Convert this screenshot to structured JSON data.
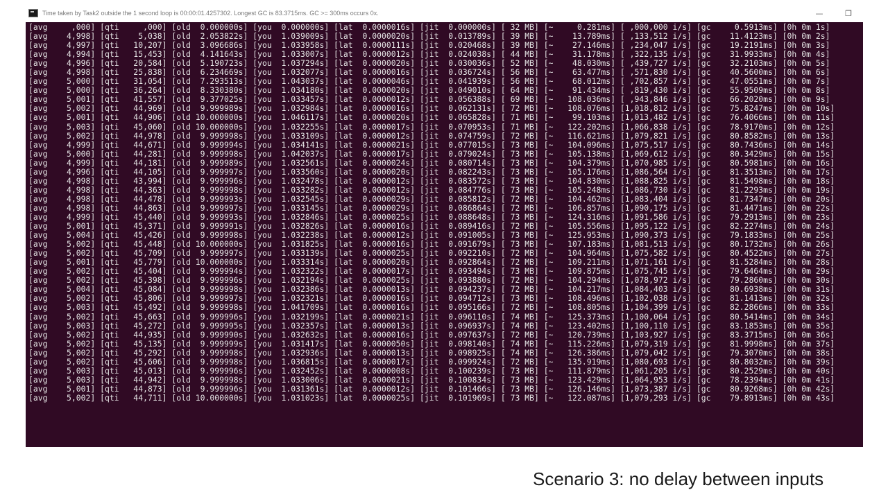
{
  "window": {
    "title": "Time taken by Task2 outside the 1 second loop is 00:00:01.4257302. Longest GC is 83.3715ms. GC >= 300ms occurs 0x.",
    "minimize_glyph": "—",
    "maximize_glyph": "❐"
  },
  "console": {
    "lines": [
      "[avg     ,000] [qti     ,000] [old  0.000000s] [you  0.000000s] [lat  0.0000016s] [jit  0.000000s] [ 32 MB] [~     0.281ms] [ ,000,000 i/s] [gc     0.5913ms] [0h 0m 1s]",
      "[avg    4,998] [qti    5,038] [old  2.053822s] [you  1.039009s] [lat  0.0000020s] [jit  0.013789s] [ 39 MB] [~    13.789ms] [ ,133,512 i/s] [gc    11.4123ms] [0h 0m 2s]",
      "[avg    4,997] [qti   10,207] [old  3.096686s] [you  1.033958s] [lat  0.0000111s] [jit  0.020468s] [ 39 MB] [~    27.146ms] [ ,234,047 i/s] [gc    19.2191ms] [0h 0m 3s]",
      "[avg    4,994] [qti   15,453] [old  4.141643s] [you  1.033007s] [lat  0.0000012s] [jit  0.024038s] [ 44 MB] [~    31.178ms] [ ,322,135 i/s] [gc    31.9933ms] [0h 0m 4s]",
      "[avg    4,996] [qti   20,584] [old  5.190723s] [you  1.037294s] [lat  0.0000020s] [jit  0.030036s] [ 52 MB] [~    48.030ms] [ ,439,727 i/s] [gc    32.2103ms] [0h 0m 5s]",
      "[avg    4,998] [qti   25,838] [old  6.234669s] [you  1.032077s] [lat  0.0000016s] [jit  0.036724s] [ 56 MB] [~    63.477ms] [ ,571,830 i/s] [gc    40.5600ms] [0h 0m 6s]",
      "[avg    5,000] [qti   31,054] [old  7.293513s] [you  1.043037s] [lat  0.0000046s] [jit  0.041939s] [ 56 MB] [~    68.012ms] [ ,702,857 i/s] [gc    47.0551ms] [0h 0m 7s]",
      "[avg    5,000] [qti   36,264] [old  8.330380s] [you  1.034180s] [lat  0.0000020s] [jit  0.049010s] [ 64 MB] [~    91.434ms] [ ,819,430 i/s] [gc    55.9509ms] [0h 0m 8s]",
      "[avg    5,001] [qti   41,557] [old  9.377025s] [you  1.033457s] [lat  0.0000012s] [jit  0.056388s] [ 69 MB] [~   108.036ms] [ ,943,846 i/s] [gc    66.2020ms] [0h 0m 9s]",
      "[avg    5,002] [qti   44,969] [old  9.999989s] [you  1.032984s] [lat  0.0000016s] [jit  0.062131s] [ 72 MB] [~   108.076ms] [1,018,812 i/s] [gc    75.8247ms] [0h 0m 10s]",
      "[avg    5,001] [qti   44,906] [old 10.000000s] [you  1.046117s] [lat  0.0000020s] [jit  0.065828s] [ 71 MB] [~    99.103ms] [1,013,482 i/s] [gc    76.4066ms] [0h 0m 11s]",
      "[avg    5,003] [qti   45,060] [old 10.000000s] [you  1.032255s] [lat  0.0000017s] [jit  0.070953s] [ 71 MB] [~   122.202ms] [1,066,838 i/s] [gc    78.9170ms] [0h 0m 12s]",
      "[avg    5,002] [qti   44,978] [old  9.999998s] [you  1.033109s] [lat  0.0000012s] [jit  0.074759s] [ 72 MB] [~   116.621ms] [1,079,821 i/s] [gc    80.8582ms] [0h 0m 13s]",
      "[avg    4,999] [qti   44,671] [old  9.999994s] [you  1.034141s] [lat  0.0000021s] [jit  0.077015s] [ 73 MB] [~   104.096ms] [1,075,517 i/s] [gc    80.7436ms] [0h 0m 14s]",
      "[avg    5,000] [qti   44,281] [old  9.999998s] [you  1.042037s] [lat  0.0000017s] [jit  0.079024s] [ 73 MB] [~   105.138ms] [1,069,612 i/s] [gc    80.3429ms] [0h 0m 15s]",
      "[avg    4,999] [qti   44,181] [old  9.999989s] [you  1.032561s] [lat  0.0000024s] [jit  0.080714s] [ 73 MB] [~   104.379ms] [1,070,985 i/s] [gc    80.5981ms] [0h 0m 16s]",
      "[avg    4,996] [qti   44,105] [old  9.999997s] [you  1.033560s] [lat  0.0000020s] [jit  0.082243s] [ 73 MB] [~   105.176ms] [1,086,564 i/s] [gc    81.3513ms] [0h 0m 17s]",
      "[avg    4,998] [qti   43,994] [old  9.999996s] [you  1.032478s] [lat  0.0000012s] [jit  0.083572s] [ 73 MB] [~   104.830ms] [1,088,825 i/s] [gc    81.5498ms] [0h 0m 18s]",
      "[avg    4,998] [qti   44,363] [old  9.999998s] [you  1.033282s] [lat  0.0000012s] [jit  0.084776s] [ 73 MB] [~   105.248ms] [1,086,730 i/s] [gc    81.2293ms] [0h 0m 19s]",
      "[avg    4,998] [qti   44,478] [old  9.999993s] [you  1.032545s] [lat  0.0000029s] [jit  0.085812s] [ 72 MB] [~   104.462ms] [1,083,404 i/s] [gc    81.7347ms] [0h 0m 20s]",
      "[avg    4,998] [qti   44,863] [old  9.999997s] [you  1.033145s] [lat  0.0000029s] [jit  0.086864s] [ 72 MB] [~   106.857ms] [1,090,175 i/s] [gc    81.4471ms] [0h 0m 22s]",
      "[avg    4,999] [qti   45,440] [old  9.999993s] [you  1.032846s] [lat  0.0000025s] [jit  0.088648s] [ 73 MB] [~   124.316ms] [1,091,586 i/s] [gc    79.2913ms] [0h 0m 23s]",
      "[avg    5,001] [qti   45,371] [old  9.999991s] [you  1.032826s] [lat  0.0000016s] [jit  0.089416s] [ 72 MB] [~   105.556ms] [1,095,122 i/s] [gc    82.2274ms] [0h 0m 24s]",
      "[avg    5,004] [qti   45,426] [old  9.999998s] [you  1.032238s] [lat  0.0000012s] [jit  0.091005s] [ 73 MB] [~   125.953ms] [1,090,373 i/s] [gc    79.1833ms] [0h 0m 25s]",
      "[avg    5,002] [qti   45,448] [old 10.000000s] [you  1.031825s] [lat  0.0000016s] [jit  0.091679s] [ 73 MB] [~   107.183ms] [1,081,513 i/s] [gc    80.1732ms] [0h 0m 26s]",
      "[avg    5,002] [qti   45,709] [old  9.999997s] [you  1.033139s] [lat  0.0000025s] [jit  0.092210s] [ 72 MB] [~   104.964ms] [1,075,582 i/s] [gc    80.4522ms] [0h 0m 27s]",
      "[avg    5,001] [qti   45,779] [old 10.000000s] [you  1.033314s] [lat  0.0000020s] [jit  0.092864s] [ 72 MB] [~   109.211ms] [1,071,161 i/s] [gc    81.5284ms] [0h 0m 28s]",
      "[avg    5,002] [qti   45,404] [old  9.999994s] [you  1.032322s] [lat  0.0000017s] [jit  0.093494s] [ 73 MB] [~   109.875ms] [1,075,745 i/s] [gc    79.6464ms] [0h 0m 29s]",
      "[avg    5,002] [qti   45,398] [old  9.999996s] [you  1.032194s] [lat  0.0000025s] [jit  0.093880s] [ 72 MB] [~   104.294ms] [1,078,972 i/s] [gc    79.2860ms] [0h 0m 30s]",
      "[avg    5,004] [qti   45,084] [old  9.999998s] [you  1.032386s] [lat  0.0000013s] [jit  0.094237s] [ 72 MB] [~   104.217ms] [1,084,403 i/s] [gc    80.6938ms] [0h 0m 31s]",
      "[avg    5,002] [qti   45,806] [old  9.999997s] [you  1.032321s] [lat  0.0000016s] [jit  0.094712s] [ 73 MB] [~   108.496ms] [1,102,038 i/s] [gc    81.1413ms] [0h 0m 32s]",
      "[avg    5,003] [qti   45,492] [old  9.999998s] [you  1.041709s] [lat  0.0000016s] [jit  0.095166s] [ 72 MB] [~   108.805ms] [1,104,399 i/s] [gc    82.2866ms] [0h 0m 33s]",
      "[avg    5,002] [qti   45,663] [old  9.999996s] [you  1.032199s] [lat  0.0000021s] [jit  0.096110s] [ 74 MB] [~   125.373ms] [1,100,064 i/s] [gc    80.5414ms] [0h 0m 34s]",
      "[avg    5,003] [qti   45,272] [old  9.999995s] [you  1.032357s] [lat  0.0000013s] [jit  0.096937s] [ 74 MB] [~   123.402ms] [1,100,110 i/s] [gc    83.1853ms] [0h 0m 35s]",
      "[avg    5,002] [qti   44,935] [old  9.999990s] [you  1.032632s] [lat  0.0000016s] [jit  0.097637s] [ 72 MB] [~   120.739ms] [1,103,927 i/s] [gc    83.3715ms] [0h 0m 36s]",
      "[avg    5,002] [qti   45,135] [old  9.999999s] [you  1.031417s] [lat  0.0000050s] [jit  0.098140s] [ 74 MB] [~   115.226ms] [1,079,319 i/s] [gc    81.9998ms] [0h 0m 37s]",
      "[avg    5,002] [qti   45,292] [old  9.999998s] [you  1.032936s] [lat  0.0000013s] [jit  0.098925s] [ 74 MB] [~   126.386ms] [1,079,042 i/s] [gc    79.3070ms] [0h 0m 38s]",
      "[avg    5,002] [qti   45,606] [old  9.999998s] [you  1.036815s] [lat  0.0000017s] [jit  0.099924s] [ 72 MB] [~   135.919ms] [1,080,693 i/s] [gc    80.8032ms] [0h 0m 39s]",
      "[avg    5,003] [qti   45,013] [old  9.999996s] [you  1.032452s] [lat  0.0000008s] [jit  0.100239s] [ 73 MB] [~   111.879ms] [1,061,205 i/s] [gc    80.2529ms] [0h 0m 40s]",
      "[avg    5,003] [qti   44,942] [old  9.999998s] [you  1.033006s] [lat  0.0000021s] [jit  0.100834s] [ 73 MB] [~   123.429ms] [1,064,953 i/s] [gc    78.2394ms] [0h 0m 41s]",
      "[avg    5,001] [qti   44,873] [old  9.999996s] [you  1.031361s] [lat  0.0000012s] [jit  0.101466s] [ 73 MB] [~   126.146ms] [1,073,387 i/s] [gc    80.9268ms] [0h 0m 42s]",
      "[avg    5,002] [qti   44,711] [old 10.000000s] [you  1.031023s] [lat  0.0000025s] [jit  0.101969s] [ 73 MB] [~   122.087ms] [1,079,293 i/s] [gc    79.8913ms] [0h 0m 43s]"
    ]
  },
  "caption": "Scenario 3: no delay between inputs",
  "colors": {
    "console_bg": "#300a24",
    "console_text": "#e6e6e6",
    "titlebar_bg": "#ffffff",
    "title_text": "#7a7a7a"
  },
  "icons": {
    "app": "console-icon",
    "minimize": "minimize-icon",
    "maximize": "maximize-icon"
  }
}
